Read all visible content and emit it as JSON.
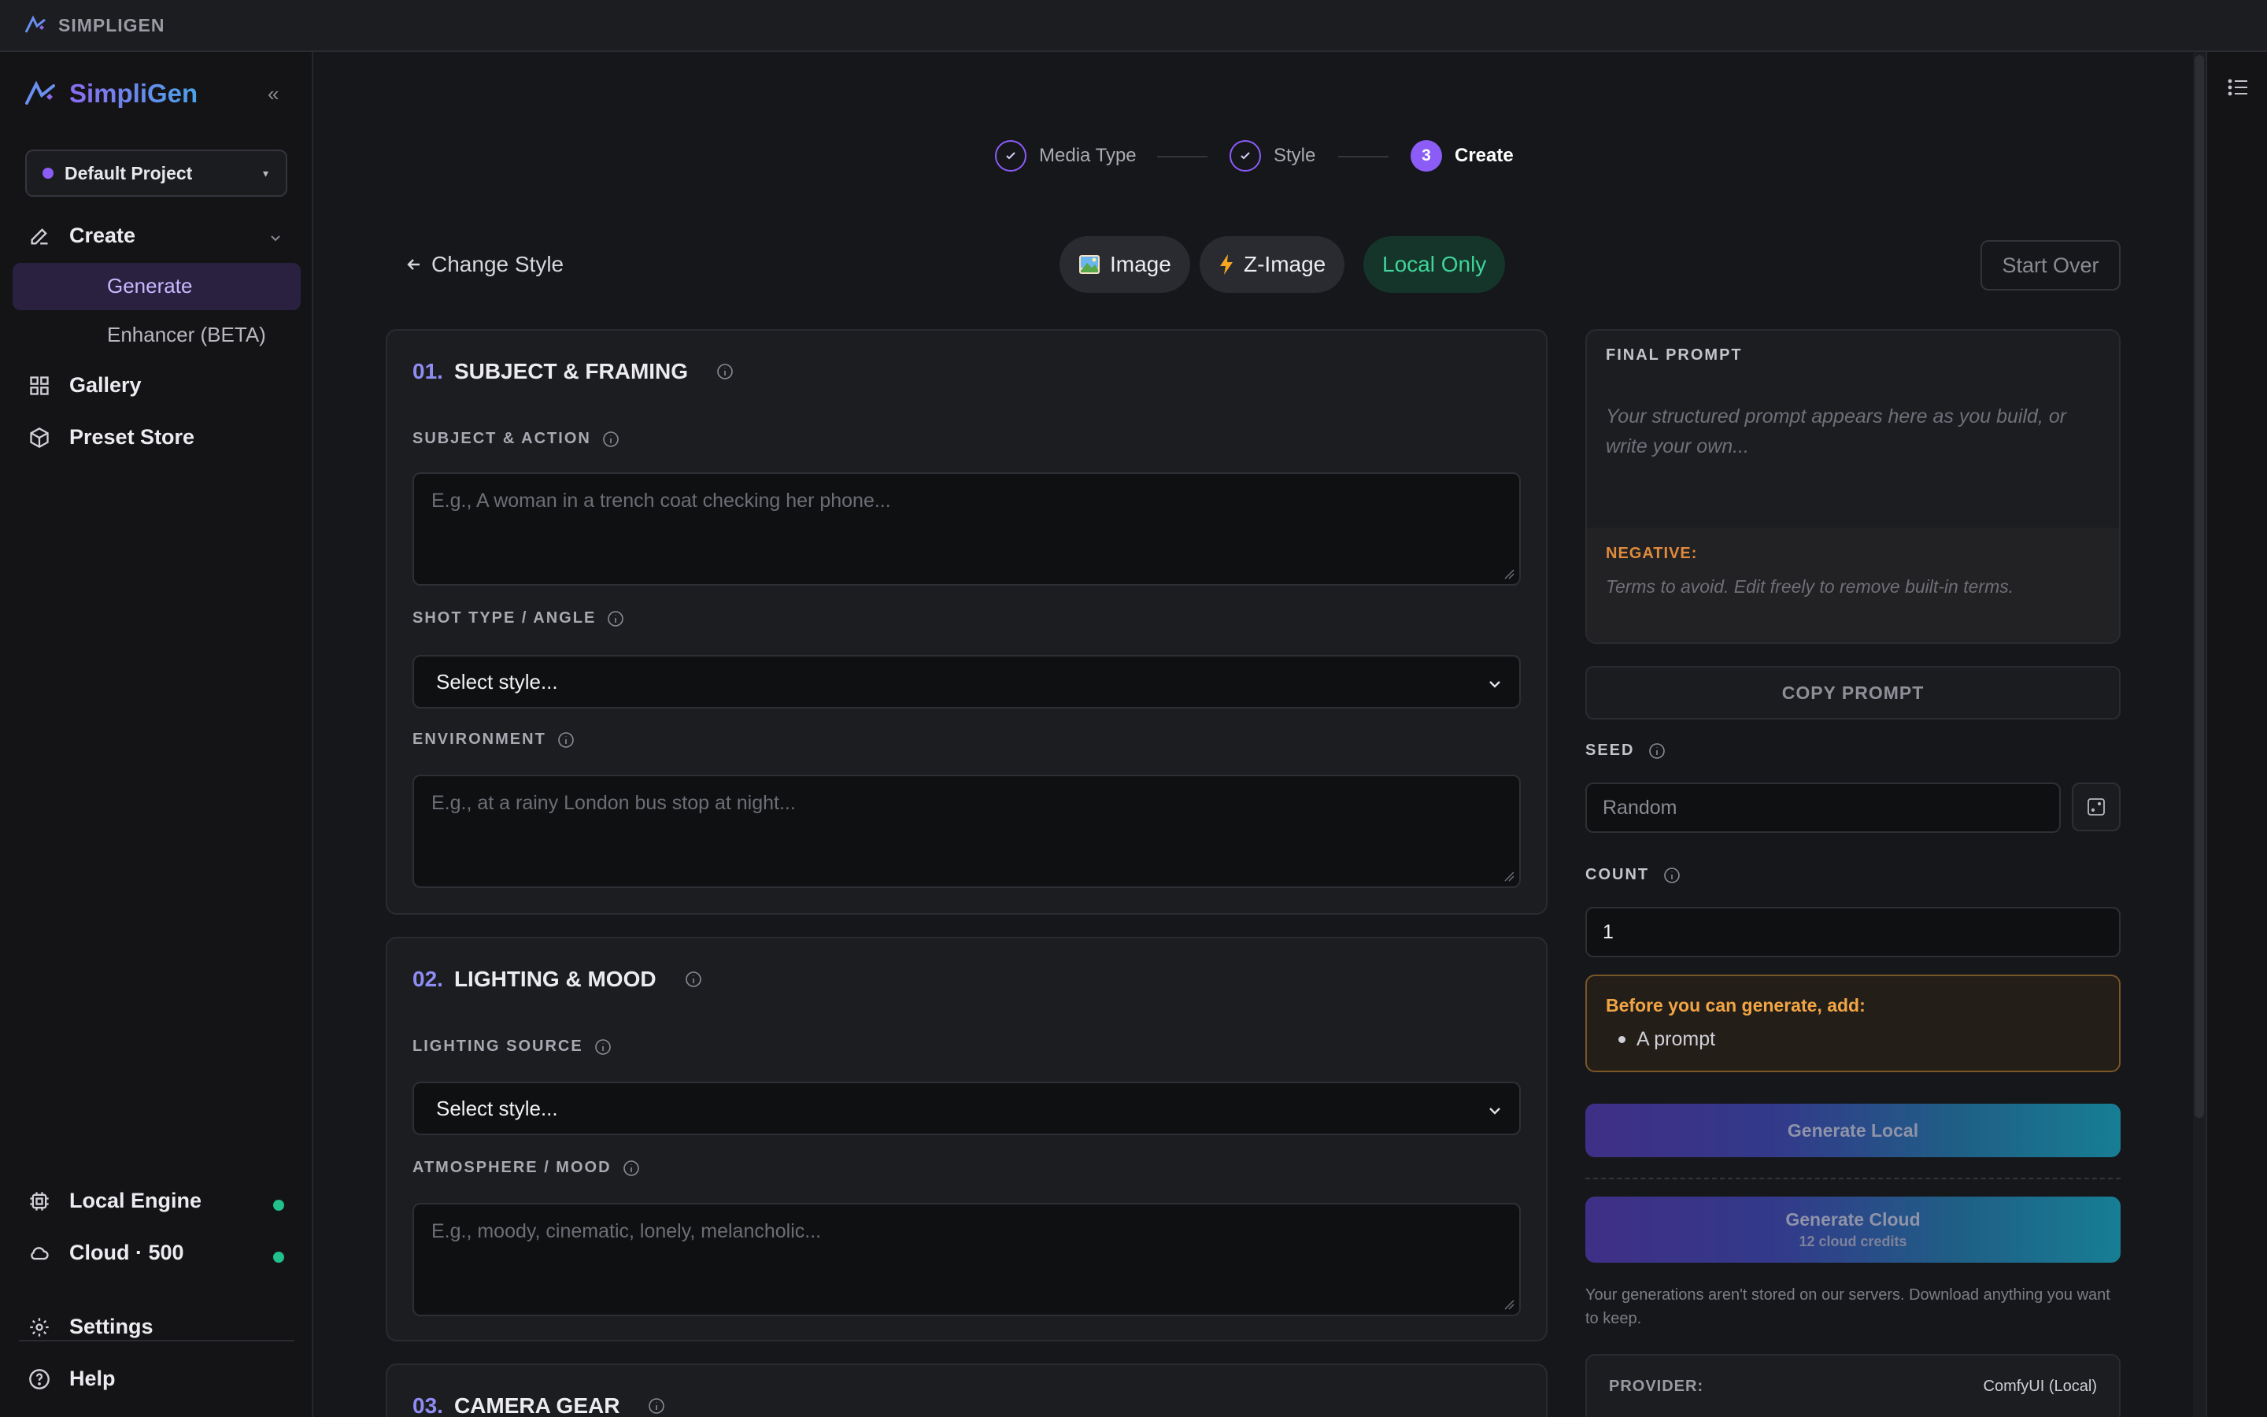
{
  "window": {
    "title": "SIMPLIGEN"
  },
  "sidebar": {
    "brand": "SimpliGen",
    "collapse_glyph": "«",
    "project": "Default Project",
    "create_label": "Create",
    "generate_label": "Generate",
    "enhancer_label": "Enhancer (BETA)",
    "gallery_label": "Gallery",
    "preset_label": "Preset Store",
    "local_engine_label": "Local Engine",
    "cloud_label": "Cloud · 500",
    "settings_label": "Settings",
    "help_label": "Help",
    "status_color": "#22c08a"
  },
  "stepper": {
    "step1": "Media Type",
    "step2": "Style",
    "step3_num": "3",
    "step3": "Create"
  },
  "toolbar": {
    "back_label": "Change Style",
    "image_pill": "Image",
    "zimage_pill": "Z-Image",
    "local_pill": "Local Only",
    "start_over": "Start Over"
  },
  "sections": {
    "s1": {
      "num": "01.",
      "title": "SUBJECT & FRAMING",
      "subject_label": "SUBJECT & ACTION",
      "subject_placeholder": "E.g., A woman in a trench coat checking her phone...",
      "shot_label": "SHOT TYPE / ANGLE",
      "shot_value": "Select style...",
      "env_label": "ENVIRONMENT",
      "env_placeholder": "E.g., at a rainy London bus stop at night..."
    },
    "s2": {
      "num": "02.",
      "title": "LIGHTING & MOOD",
      "lighting_label": "LIGHTING SOURCE",
      "lighting_value": "Select style...",
      "mood_label": "ATMOSPHERE / MOOD",
      "mood_placeholder": "E.g., moody, cinematic, lonely, melancholic..."
    },
    "s3": {
      "num": "03.",
      "title": "CAMERA GEAR"
    }
  },
  "panel": {
    "final_prompt_label": "FINAL PROMPT",
    "final_prompt_placeholder": "Your structured prompt appears here as you build, or write your own...",
    "negative_label": "NEGATIVE:",
    "negative_placeholder": "Terms to avoid. Edit freely to remove built-in terms.",
    "copy_label": "COPY PROMPT",
    "seed_label": "SEED",
    "seed_placeholder": "Random",
    "count_label": "COUNT",
    "count_value": "1",
    "warn_heading": "Before you can generate, add:",
    "warn_item": "A prompt",
    "gen_local": "Generate Local",
    "gen_cloud": "Generate Cloud",
    "gen_cloud_sub": "12 cloud credits",
    "note": "Your generations aren't stored on our servers. Download anything you want to keep.",
    "provider_label": "PROVIDER:",
    "provider_value": "ComfyUI (Local)"
  },
  "colors": {
    "accent": "#8b5cf6",
    "success": "#3fd49a",
    "warning": "#f2a545"
  }
}
